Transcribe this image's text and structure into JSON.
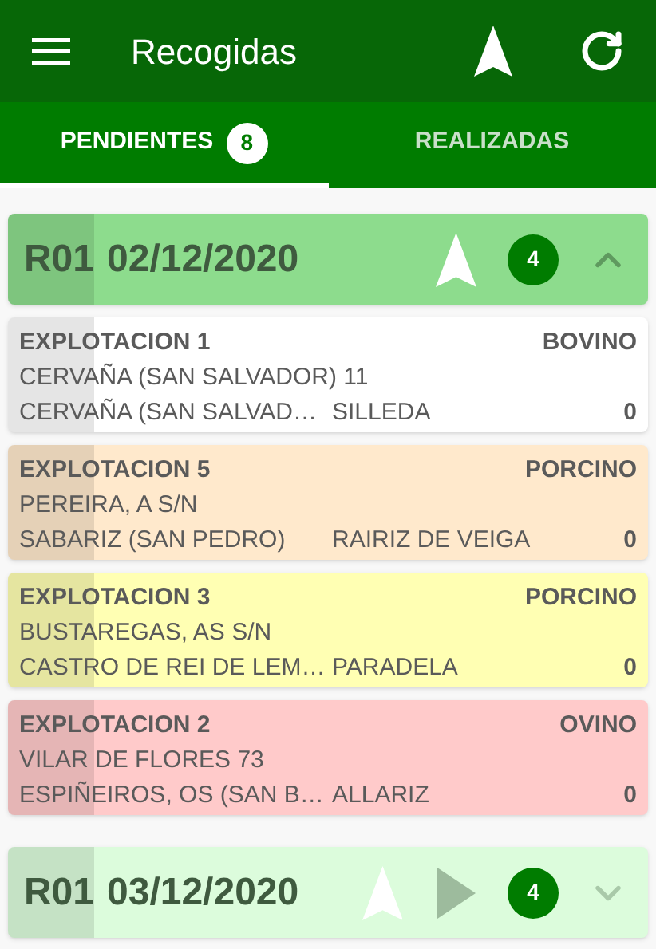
{
  "app_bar": {
    "title": "Recogidas"
  },
  "tabs": [
    {
      "label": "PENDIENTES",
      "badge": "8",
      "selected": true
    },
    {
      "label": "REALIZADAS",
      "selected": false
    }
  ],
  "groups": [
    {
      "route": "R01",
      "date": "02/12/2020",
      "count": "4",
      "expanded": true,
      "play": false,
      "cards": [
        {
          "name": "EXPLOTACION 1",
          "species": "BOVINO",
          "address": "CERVAÑA (SAN SALVADOR) 11",
          "parish": "CERVAÑA (SAN SALVAD…",
          "municipality": "SILLEDA",
          "quantity": "0",
          "color": "#ffffff"
        },
        {
          "name": "EXPLOTACION 5",
          "species": "PORCINO",
          "address": "PEREIRA, A S/N",
          "parish": "SABARIZ (SAN PEDRO)",
          "municipality": "RAIRIZ DE VEIGA",
          "quantity": "0",
          "color": "#ffe9cc"
        },
        {
          "name": "EXPLOTACION 3",
          "species": "PORCINO",
          "address": "BUSTAREGAS, AS S/N",
          "parish": "CASTRO DE REI DE LEM…",
          "municipality": "PARADELA",
          "quantity": "0",
          "color": "#ffffb3"
        },
        {
          "name": "EXPLOTACION 2",
          "species": "OVINO",
          "address": "VILAR DE FLORES 73",
          "parish": "ESPIÑEIROS, OS (SAN B…",
          "municipality": "ALLARIZ",
          "quantity": "0",
          "color": "#ffcaca"
        }
      ]
    },
    {
      "route": "R01",
      "date": "03/12/2020",
      "count": "4",
      "expanded": false,
      "play": true
    }
  ]
}
